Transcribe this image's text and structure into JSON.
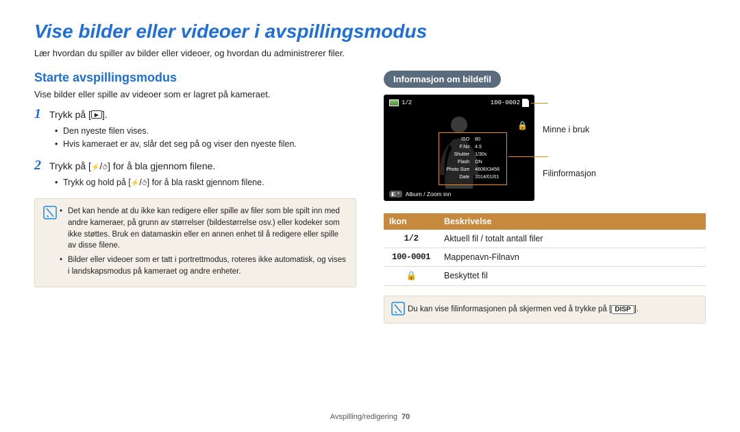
{
  "page": {
    "title": "Vise bilder eller videoer i avspillingsmodus",
    "intro": "Lær hvordan du spiller av bilder eller videoer, og hvordan du administrerer filer."
  },
  "left": {
    "section_title": "Starte avspillingsmodus",
    "section_sub": "Vise bilder eller spille av videoer som er lagret på kameraet.",
    "step1": {
      "num": "1",
      "text_before": "Trykk på [",
      "text_after": "]."
    },
    "step1_bullets": [
      "Den nyeste filen vises.",
      "Hvis kameraet er av, slår det seg på og viser den nyeste filen."
    ],
    "step2": {
      "num": "2",
      "text_before": "Trykk på [",
      "text_mid": "/",
      "text_after": "] for å bla gjennom filene."
    },
    "step2_bullets_before": "Trykk og hold på [",
    "step2_bullets_mid": "/",
    "step2_bullets_after": "] for å bla raskt gjennom filene.",
    "note_items": [
      "Det kan hende at du ikke kan redigere eller spille av filer som ble spilt inn med andre kameraer, på grunn av størrelser (bildestørrelse osv.) eller kodeker som ikke støttes. Bruk en datamaskin eller en annen enhet til å redigere eller spille av disse filene.",
      "Bilder eller videoer som er tatt i portrettmodus, roteres ikke automatisk, og vises i landskapsmodus på kameraet og andre enheter."
    ]
  },
  "right": {
    "badge": "Informasjon om bildefil",
    "screen": {
      "counter": "1/2",
      "file_num": "100-0002",
      "info_rows": [
        {
          "k": "ISO",
          "v": "80"
        },
        {
          "k": "F.No",
          "v": "4.5"
        },
        {
          "k": "Shutter",
          "v": "1/30s"
        },
        {
          "k": "Flash",
          "v": "ON"
        },
        {
          "k": "Photo Size",
          "v": "4608X3456"
        },
        {
          "k": "Date",
          "v": "2014/01/01"
        }
      ],
      "bottom": "Album / Zoom inn"
    },
    "annot_memory": "Minne i bruk",
    "annot_fileinfo": "Filinformasjon",
    "table": {
      "h1": "Ikon",
      "h2": "Beskrivelse",
      "rows": [
        {
          "icon": "1/2",
          "desc": "Aktuell fil / totalt antall filer"
        },
        {
          "icon": "100-0001",
          "desc": "Mappenavn-Filnavn"
        },
        {
          "icon": "lock",
          "desc": "Beskyttet fil"
        }
      ]
    },
    "note_single_before": "Du kan vise filinformasjonen på skjermen ved å trykke på [",
    "note_single_disp": "DISP",
    "note_single_after": "]."
  },
  "footer": {
    "section": "Avspilling/redigering",
    "page": "70"
  }
}
